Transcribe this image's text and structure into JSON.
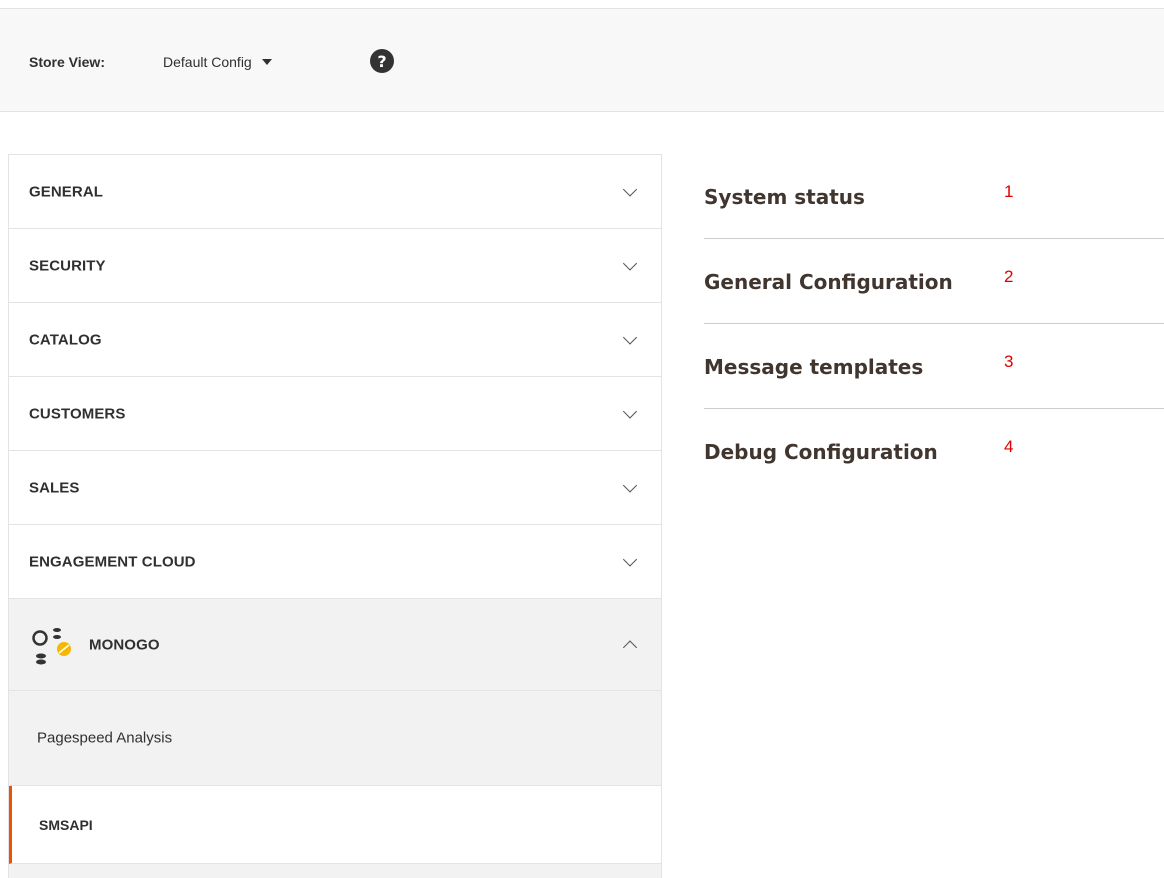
{
  "store_view": {
    "label": "Store View:",
    "selected": "Default Config",
    "help_glyph": "?"
  },
  "nav": {
    "items": [
      {
        "label": "GENERAL"
      },
      {
        "label": "SECURITY"
      },
      {
        "label": "CATALOG"
      },
      {
        "label": "CUSTOMERS"
      },
      {
        "label": "SALES"
      },
      {
        "label": "ENGAGEMENT CLOUD"
      }
    ],
    "open_group": {
      "label": "MONOGO",
      "logo_icon": "monogo-logo-icon",
      "children": [
        {
          "label": "Pagespeed Analysis"
        },
        {
          "label": "SMSAPI"
        }
      ]
    }
  },
  "sections": [
    {
      "title": "System status",
      "num": "1"
    },
    {
      "title": "General Configuration",
      "num": "2"
    },
    {
      "title": "Message templates",
      "num": "3"
    },
    {
      "title": "Debug Configuration",
      "num": "4"
    }
  ],
  "colors": {
    "accent": "#eb5202",
    "annotation": "#e00000",
    "section_title": "#41362f"
  }
}
